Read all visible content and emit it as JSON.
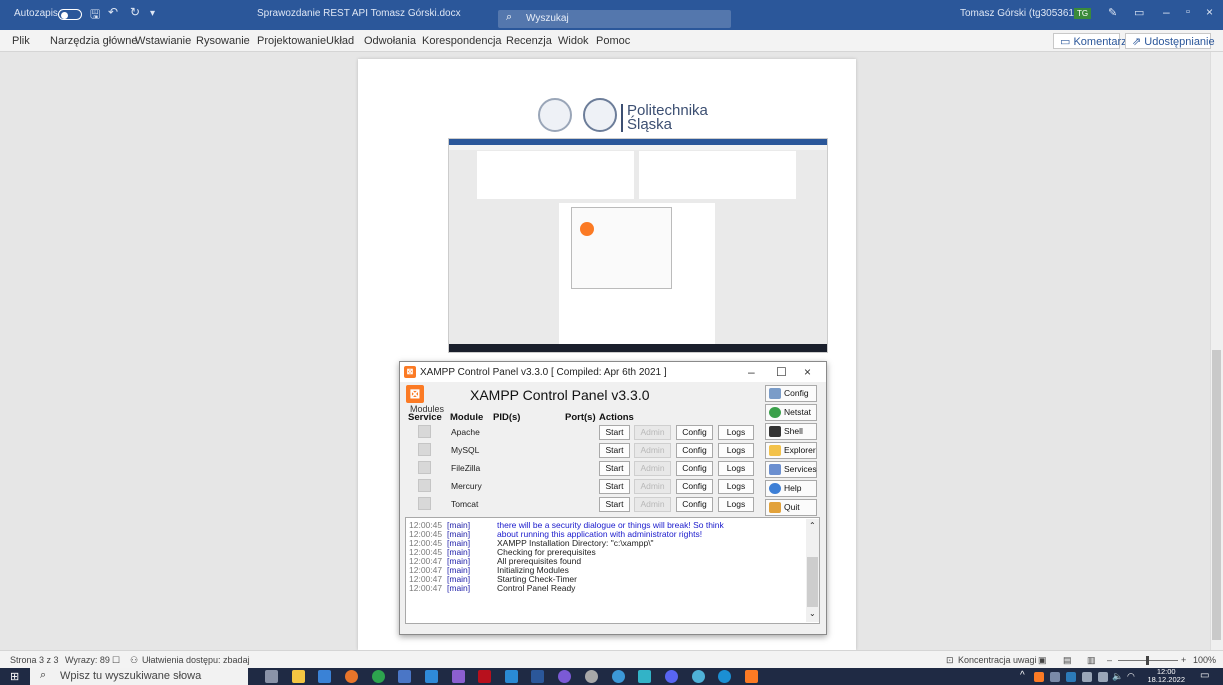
{
  "titlebar": {
    "autosave": "Autozapis",
    "document_title": "Sprawozdanie REST API Tomasz Górski.docx",
    "search_placeholder": "Wyszukaj",
    "user": "Tomasz Górski (tg305361)",
    "user_initials": "TG"
  },
  "ribbon": {
    "tabs": [
      "Plik",
      "Narzędzia główne",
      "Wstawianie",
      "Rysowanie",
      "Projektowanie",
      "Układ",
      "Odwołania",
      "Korespondencja",
      "Recenzja",
      "Widok",
      "Pomoc"
    ],
    "comments_label": "Komentarze",
    "share_label": "Udostępnianie"
  },
  "document": {
    "logo_text_line1": "Politechnika",
    "logo_text_line2": "Śląska"
  },
  "xampp": {
    "window_title": "XAMPP Control Panel v3.3.0  [ Compiled: Apr 6th 2021 ]",
    "header": "XAMPP Control Panel v3.3.0",
    "modules_label": "Modules",
    "columns": {
      "service": "Service",
      "module": "Module",
      "pid": "PID(s)",
      "port": "Port(s)",
      "actions": "Actions"
    },
    "modules": [
      {
        "name": "Apache"
      },
      {
        "name": "MySQL"
      },
      {
        "name": "FileZilla"
      },
      {
        "name": "Mercury"
      },
      {
        "name": "Tomcat"
      }
    ],
    "action_labels": {
      "start": "Start",
      "admin": "Admin",
      "config": "Config",
      "logs": "Logs"
    },
    "side_buttons": [
      {
        "label": "Config",
        "icon": "wrench-icon",
        "color": "#7a9cc8"
      },
      {
        "label": "Netstat",
        "icon": "globe-icon",
        "color": "#3aa04a"
      },
      {
        "label": "Shell",
        "icon": "terminal-icon",
        "color": "#333333"
      },
      {
        "label": "Explorer",
        "icon": "folder-icon",
        "color": "#f3c24a"
      },
      {
        "label": "Services",
        "icon": "services-icon",
        "color": "#6b8fd0"
      },
      {
        "label": "Help",
        "icon": "help-icon",
        "color": "#3d7fd6"
      },
      {
        "label": "Quit",
        "icon": "quit-icon",
        "color": "#e2a23b"
      }
    ],
    "log": [
      {
        "time": "12:00:45",
        "src": "[main]",
        "msg": "there will be a security dialogue or things will break! So think",
        "blue": true
      },
      {
        "time": "12:00:45",
        "src": "[main]",
        "msg": "about running this application with administrator rights!",
        "blue": true
      },
      {
        "time": "12:00:45",
        "src": "[main]",
        "msg": "XAMPP Installation Directory: \"c:\\xampp\\\"",
        "blue": false
      },
      {
        "time": "12:00:45",
        "src": "[main]",
        "msg": "Checking for prerequisites",
        "blue": false
      },
      {
        "time": "12:00:47",
        "src": "[main]",
        "msg": "All prerequisites found",
        "blue": false
      },
      {
        "time": "12:00:47",
        "src": "[main]",
        "msg": "Initializing Modules",
        "blue": false
      },
      {
        "time": "12:00:47",
        "src": "[main]",
        "msg": "Starting Check-Timer",
        "blue": false
      },
      {
        "time": "12:00:47",
        "src": "[main]",
        "msg": "Control Panel Ready",
        "blue": false
      }
    ]
  },
  "statusbar": {
    "page": "Strona 3 z 3",
    "words": "Wyrazy: 89",
    "accessibility": "Ułatwienia dostępu: zbadaj",
    "focus": "Koncentracja uwagi",
    "zoom": "100%"
  },
  "taskbar": {
    "search_placeholder": "Wpisz tu wyszukiwane słowa",
    "time": "12:00",
    "date": "18.12.2022"
  },
  "colors": {
    "word_blue": "#2b579a",
    "xampp_orange": "#fb7a24"
  }
}
